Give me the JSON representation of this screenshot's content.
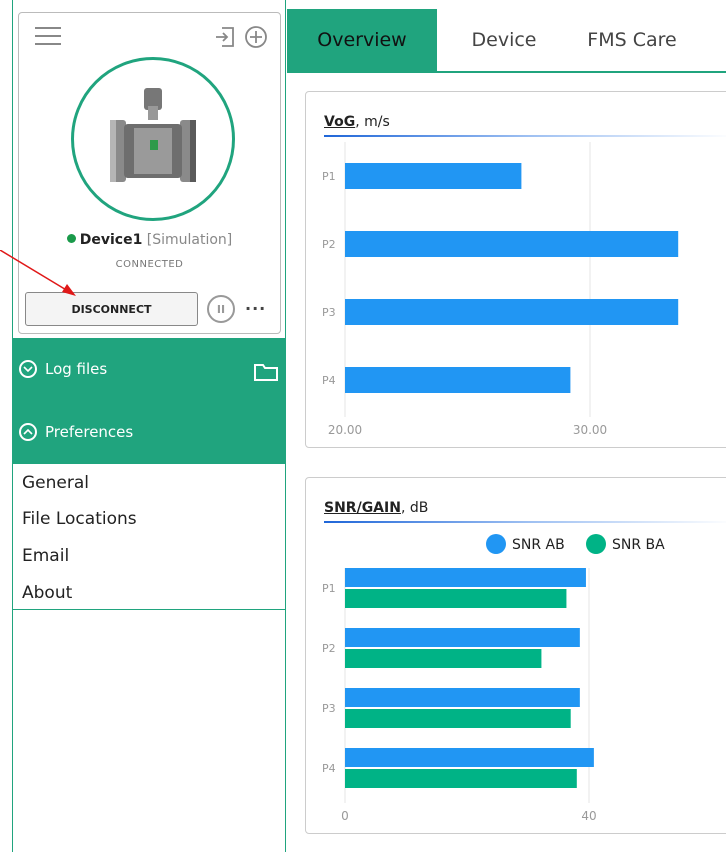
{
  "sidebar": {
    "device": {
      "name": "Device1",
      "mode": "[Simulation]",
      "status": "CONNECTED",
      "disconnect_label": "DISCONNECT",
      "more_label": "···",
      "status_color": "#1a9a4a"
    },
    "accordion": {
      "log_files_label": "Log files",
      "preferences_label": "Preferences"
    },
    "preferences_items": [
      "General",
      "File Locations",
      "Email",
      "About"
    ]
  },
  "tabs": [
    {
      "label": "Overview",
      "active": true
    },
    {
      "label": "Device",
      "active": false
    },
    {
      "label": "FMS Care",
      "active": false
    }
  ],
  "colors": {
    "accent": "#20a47e",
    "bar_blue": "#2196f3",
    "bar_green": "#00b386"
  },
  "chart_data": [
    {
      "type": "bar",
      "title": "VoG",
      "unit": "m/s",
      "orientation": "horizontal",
      "categories": [
        "P1",
        "P2",
        "P3",
        "P4"
      ],
      "series": [
        {
          "values": [
            27.2,
            33.6,
            33.6,
            29.2
          ]
        }
      ],
      "xlim": [
        20,
        34
      ],
      "xticks": [
        "20.00",
        "30.00"
      ]
    },
    {
      "type": "bar",
      "title": "SNR/GAIN",
      "unit": "dB",
      "orientation": "horizontal",
      "categories": [
        "P1",
        "P2",
        "P3",
        "P4"
      ],
      "series": [
        {
          "name": "SNR AB",
          "values": [
            39.5,
            38.5,
            38.5,
            40.8
          ]
        },
        {
          "name": "SNR BA",
          "values": [
            36.3,
            32.2,
            37.0,
            38.0
          ]
        }
      ],
      "xlim": [
        0,
        62
      ],
      "xticks": [
        "0",
        "40"
      ],
      "legend": "top-center"
    }
  ]
}
